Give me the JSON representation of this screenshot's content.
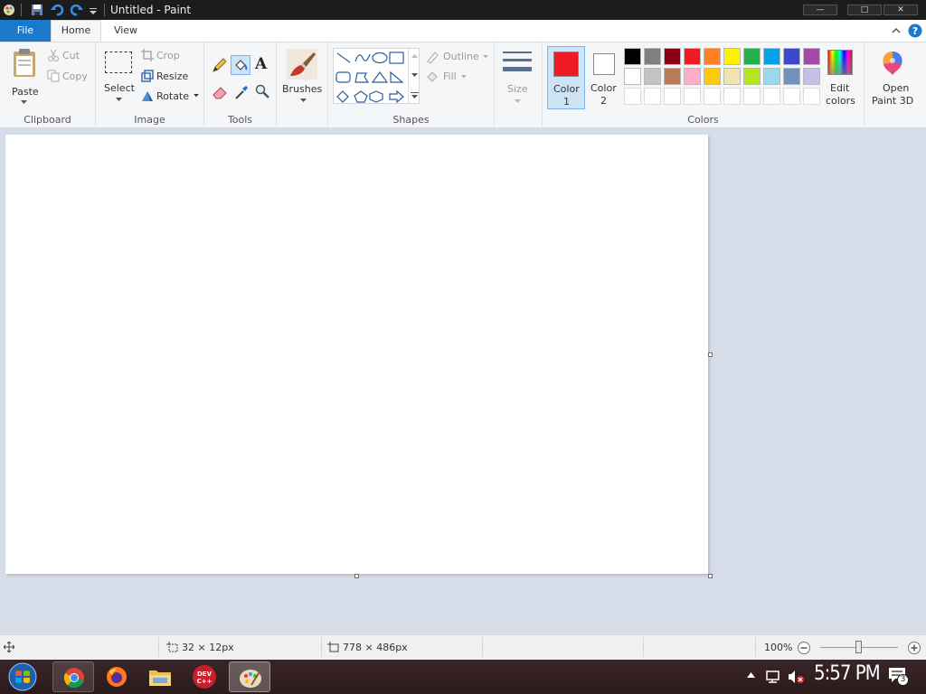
{
  "window": {
    "title": "Untitled - Paint",
    "minimize": "—",
    "maximize": "□",
    "close": "✕"
  },
  "tabs": {
    "file": "File",
    "home": "Home",
    "view": "View"
  },
  "clipboard": {
    "paste": "Paste",
    "cut": "Cut",
    "copy": "Copy",
    "group": "Clipboard"
  },
  "image": {
    "select": "Select",
    "crop": "Crop",
    "resize": "Resize",
    "rotate": "Rotate",
    "group": "Image"
  },
  "tools": {
    "group": "Tools",
    "text_tool": "A"
  },
  "brushes": {
    "label": "Brushes"
  },
  "shapes": {
    "outline": "Outline",
    "fill": "Fill",
    "group": "Shapes"
  },
  "size": {
    "label": "Size"
  },
  "colors": {
    "color1_label": "Color",
    "color1_num": "1",
    "color2_label": "Color",
    "color2_num": "2",
    "color1": "#ed1c24",
    "color2": "#ffffff",
    "edit_colors_1": "Edit",
    "edit_colors_2": "colors",
    "group": "Colors",
    "palette_row1": [
      "#000000",
      "#7f7f7f",
      "#880015",
      "#ed1c24",
      "#ff7f27",
      "#fff200",
      "#22b14c",
      "#00a2e8",
      "#3f48cc",
      "#a349a4"
    ],
    "palette_row2": [
      "#ffffff",
      "#c3c3c3",
      "#b97a57",
      "#ffaec9",
      "#ffc90e",
      "#efe4b0",
      "#b5e61d",
      "#99d9ea",
      "#7092be",
      "#c8bfe7"
    ]
  },
  "paint3d": {
    "line1": "Open",
    "line2": "Paint 3D"
  },
  "status": {
    "cursor_pos": "32 × 12px",
    "canvas_size": "778 × 486px",
    "zoom": "100%"
  },
  "taskbar": {
    "time": "5:57 PM",
    "notification_count": "3",
    "devcpp_label": "DEV C++"
  }
}
